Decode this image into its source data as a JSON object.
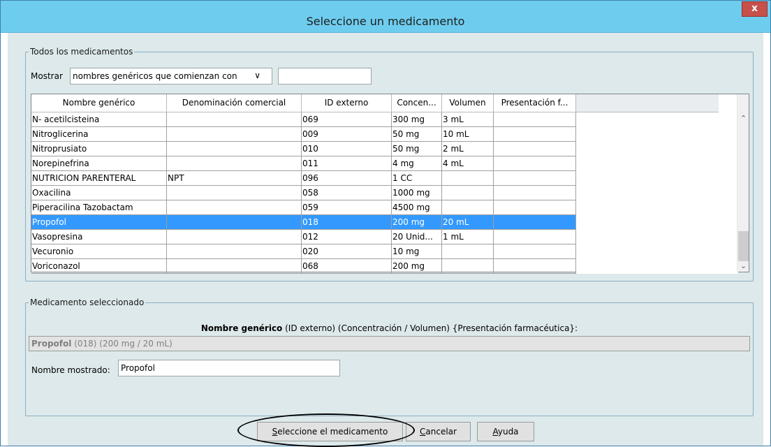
{
  "dialog": {
    "title": "Seleccione un medicamento",
    "close_label": "x"
  },
  "all_meds": {
    "legend": "Todos los medicamentos",
    "show_label": "Mostrar",
    "filter_option": "nombres genéricos que comienzan con",
    "filter_text": "",
    "dropdown_icon": "chevron-down-icon"
  },
  "table": {
    "columns": [
      "Nombre genérico",
      "Denominación comercial",
      "ID externo",
      "Concen...",
      "Volumen",
      "Presentación f..."
    ],
    "rows": [
      [
        "N- acetilcisteina",
        "",
        "069",
        "300 mg",
        "3 mL",
        ""
      ],
      [
        "Nitroglicerina",
        "",
        "009",
        "50 mg",
        "10 mL",
        ""
      ],
      [
        "Nitroprusiato",
        "",
        "010",
        "50 mg",
        "2 mL",
        ""
      ],
      [
        "Norepinefrina",
        "",
        "011",
        "4 mg",
        "4 mL",
        ""
      ],
      [
        "NUTRICION PARENTERAL",
        "NPT",
        "096",
        "1 CC",
        "",
        ""
      ],
      [
        "Oxacilina",
        "",
        "058",
        "1000 mg",
        "",
        ""
      ],
      [
        "Piperacilina Tazobactam",
        "",
        "059",
        "4500 mg",
        "",
        ""
      ],
      [
        "Propofol",
        "",
        "018",
        "200 mg",
        "20 mL",
        ""
      ],
      [
        "Vasopresina",
        "",
        "012",
        "20 Unid...",
        "1 mL",
        ""
      ],
      [
        "Vecuronio",
        "",
        "020",
        "10 mg",
        "",
        ""
      ],
      [
        "Voriconazol",
        "",
        "068",
        "200 mg",
        "",
        ""
      ]
    ],
    "selected_row": 7,
    "selection_color": "#3399ff"
  },
  "selected_med": {
    "legend": "Medicamento seleccionado",
    "heading_bold": "Nombre genérico",
    "heading_rest": " (ID externo) (Concentración / Volumen) {Presentación farmacéutica}:",
    "display_bold": "Propofol",
    "display_rest": " (018) (200 mg / 20 mL)",
    "shown_name_label": "Nombre mostrado:",
    "shown_name_value": "Propofol"
  },
  "buttons": {
    "select": "Seleccione el medicamento",
    "cancel": "Cancelar",
    "help": "Ayuda"
  },
  "colors": {
    "title_bar": "#6ecdee",
    "window_bg": "#dde9ea",
    "close_button": "#c7504a"
  }
}
